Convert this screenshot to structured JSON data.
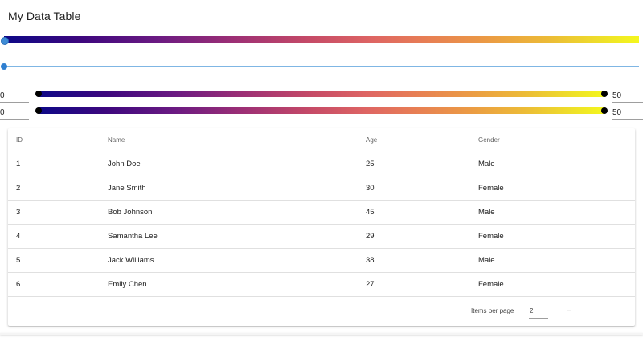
{
  "page": {
    "title": "My Data Table"
  },
  "sliders": {
    "range_a": {
      "min_value": "0",
      "max_value": "50"
    },
    "range_b": {
      "min_value": "0",
      "max_value": "50"
    }
  },
  "table": {
    "columns": [
      "ID",
      "Name",
      "Age",
      "Gender"
    ],
    "rows": [
      [
        "1",
        "John Doe",
        "25",
        "Male"
      ],
      [
        "2",
        "Jane Smith",
        "30",
        "Female"
      ],
      [
        "3",
        "Bob Johnson",
        "45",
        "Male"
      ],
      [
        "4",
        "Samantha Lee",
        "29",
        "Female"
      ],
      [
        "5",
        "Jack Williams",
        "38",
        "Male"
      ],
      [
        "6",
        "Emily Chen",
        "27",
        "Female"
      ]
    ]
  },
  "paginator": {
    "items_per_page_label": "Items per page",
    "page_size": "2",
    "range_label": "–"
  },
  "colors": {
    "gradient_start": "#0d0887",
    "gradient_end": "#f4f71d",
    "slider_accent": "#3f8cd6",
    "range_thumb": "#000000"
  }
}
